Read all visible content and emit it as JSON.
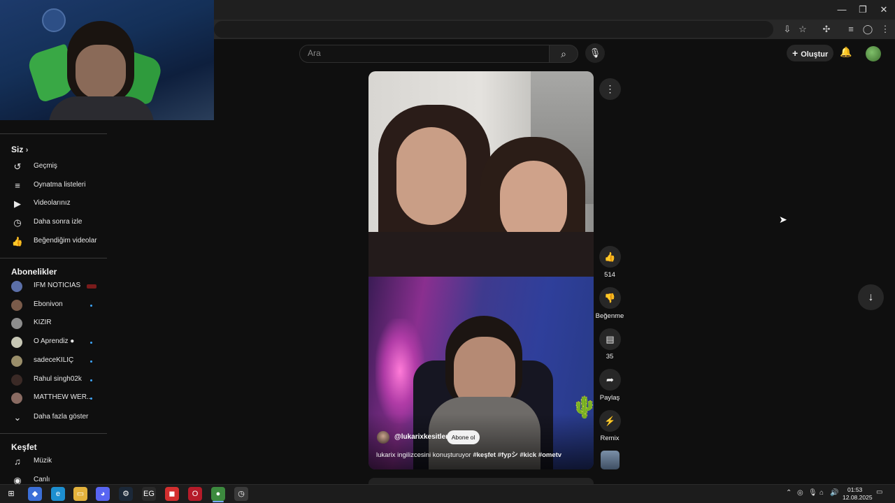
{
  "colors": {
    "page_bg": "#0f0f0f",
    "accent_blue": "#3ea6ff",
    "surface": "#272727"
  },
  "window_controls": {
    "minimize": "—",
    "restore": "❐",
    "close": "✕"
  },
  "toolbar_icons": [
    "install-app-icon",
    "bookmark-star-icon",
    "extensions-icon",
    "media-controls-icon",
    "profile-icon",
    "browser-menu-icon"
  ],
  "header": {
    "search_placeholder": "Ara",
    "search_icon": "⌕",
    "mic_icon": "🎤",
    "create_label": "Oluştur",
    "create_icon": "+",
    "bell_icon": "🔔"
  },
  "sidebar": {
    "you_heading": "Siz",
    "you_items": [
      {
        "label": "Geçmiş",
        "icon": "history-icon",
        "glyph": "↺"
      },
      {
        "label": "Oynatma listeleri",
        "icon": "playlists-icon",
        "glyph": "≡"
      },
      {
        "label": "Videolarınız",
        "icon": "your-videos-icon",
        "glyph": "▶"
      },
      {
        "label": "Daha sonra izle",
        "icon": "watch-later-icon",
        "glyph": "◷"
      },
      {
        "label": "Beğendiğim videolar",
        "icon": "liked-videos-icon",
        "glyph": "👍"
      }
    ],
    "subs_heading": "Abonelikler",
    "subscriptions": [
      {
        "label": "IFM NOTICIAS",
        "color": "#5b6fa8",
        "status": "live"
      },
      {
        "label": "Ebonivon",
        "color": "#7a5b4a",
        "status": "new"
      },
      {
        "label": "KIZIR",
        "color": "#8d8d8d",
        "status": "none"
      },
      {
        "label": "O Aprendiz ●",
        "color": "#c7c7b5",
        "status": "new"
      },
      {
        "label": "sadeceKILIÇ",
        "color": "#9a8e6a",
        "status": "new"
      },
      {
        "label": "Rahul singh02k",
        "color": "#3b2a26",
        "status": "new"
      },
      {
        "label": "MATTHEW WER...",
        "color": "#8a6b62",
        "status": "new"
      }
    ],
    "show_more": "Daha fazla göster",
    "explore_heading": "Keşfet",
    "explore_items": [
      {
        "label": "Müzik",
        "icon": "music-icon",
        "glyph": "♫"
      },
      {
        "label": "Canlı",
        "icon": "live-icon",
        "glyph": "◉"
      }
    ]
  },
  "short": {
    "channel_handle": "@lukarixkesitleri",
    "subscribe_label": "Abone ol",
    "caption_text": "lukarix ingilizcesini konuşturuyor ",
    "caption_tags": "#keşfet #fypシ #kick #ometv",
    "likes": "514",
    "dislike_label": "Beğenme",
    "comments": "35",
    "share_label": "Paylaş",
    "remix_label": "Remix"
  },
  "taskbar": {
    "apps": [
      {
        "name": "windows-start-icon",
        "glyph": "⊞",
        "bg": "transparent"
      },
      {
        "name": "copilot-icon",
        "glyph": "◆",
        "bg": "#3b6fd8"
      },
      {
        "name": "edge-icon",
        "glyph": "e",
        "bg": "#1d8fd0"
      },
      {
        "name": "file-explorer-icon",
        "glyph": "▭",
        "bg": "#e3b23c"
      },
      {
        "name": "discord-icon",
        "glyph": "◕",
        "bg": "#5865f2"
      },
      {
        "name": "steam-icon",
        "glyph": "⚙",
        "bg": "#1b2838"
      },
      {
        "name": "epic-games-icon",
        "glyph": "EG",
        "bg": "#2a2a2a"
      },
      {
        "name": "app-red-icon",
        "glyph": "◼",
        "bg": "#d32f2f"
      },
      {
        "name": "opera-icon",
        "glyph": "O",
        "bg": "#b51b29"
      },
      {
        "name": "chrome-icon",
        "glyph": "●",
        "bg": "#3c8a3e"
      },
      {
        "name": "app-clock-icon",
        "glyph": "◷",
        "bg": "#3a3a3a"
      }
    ],
    "time": "01:53",
    "date": "12.08.2025"
  }
}
